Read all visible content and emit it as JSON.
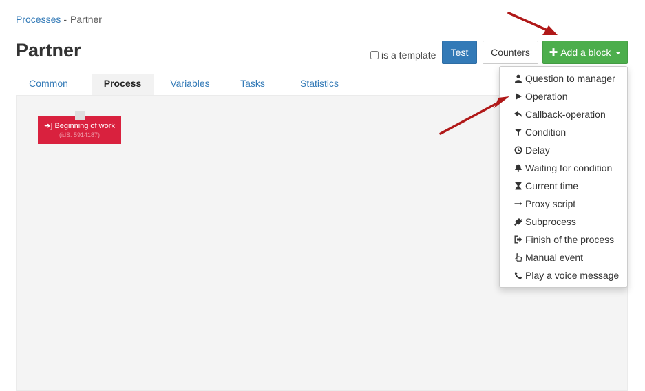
{
  "breadcrumb": {
    "root": "Processes",
    "separator": "-",
    "current": "Partner"
  },
  "page": {
    "title": "Partner"
  },
  "template": {
    "label": "is a template",
    "checked": false
  },
  "toolbar": {
    "test_label": "Test",
    "counters_label": "Counters",
    "add_block_label": "Add a block"
  },
  "tabs": [
    {
      "label": "Common",
      "active": false
    },
    {
      "label": "Process",
      "active": true
    },
    {
      "label": "Variables",
      "active": false
    },
    {
      "label": "Tasks",
      "active": false
    },
    {
      "label": "Statistics",
      "active": false
    }
  ],
  "canvas": {
    "block": {
      "title": "Beginning of work",
      "ids": "(idS: 5914187)",
      "icon": "sign-in-icon",
      "color": "#d9213e"
    }
  },
  "dropdown": {
    "items": [
      {
        "label": "Question to manager",
        "icon": "user-icon"
      },
      {
        "label": "Operation",
        "icon": "play-icon"
      },
      {
        "label": "Callback-operation",
        "icon": "reply-icon"
      },
      {
        "label": "Condition",
        "icon": "filter-icon"
      },
      {
        "label": "Delay",
        "icon": "clock-icon"
      },
      {
        "label": "Waiting for condition",
        "icon": "bell-icon"
      },
      {
        "label": "Current time",
        "icon": "hourglass-icon"
      },
      {
        "label": "Proxy script",
        "icon": "long-arrow-right-icon"
      },
      {
        "label": "Subprocess",
        "icon": "plug-icon"
      },
      {
        "label": "Finish of the process",
        "icon": "sign-out-icon"
      },
      {
        "label": "Manual event",
        "icon": "hand-pointer-icon"
      },
      {
        "label": "Play a voice message",
        "icon": "phone-icon"
      }
    ]
  },
  "colors": {
    "accent": "#337ab7",
    "success": "#4cae4c",
    "block": "#d9213e",
    "annotation_arrow": "#b01818"
  }
}
